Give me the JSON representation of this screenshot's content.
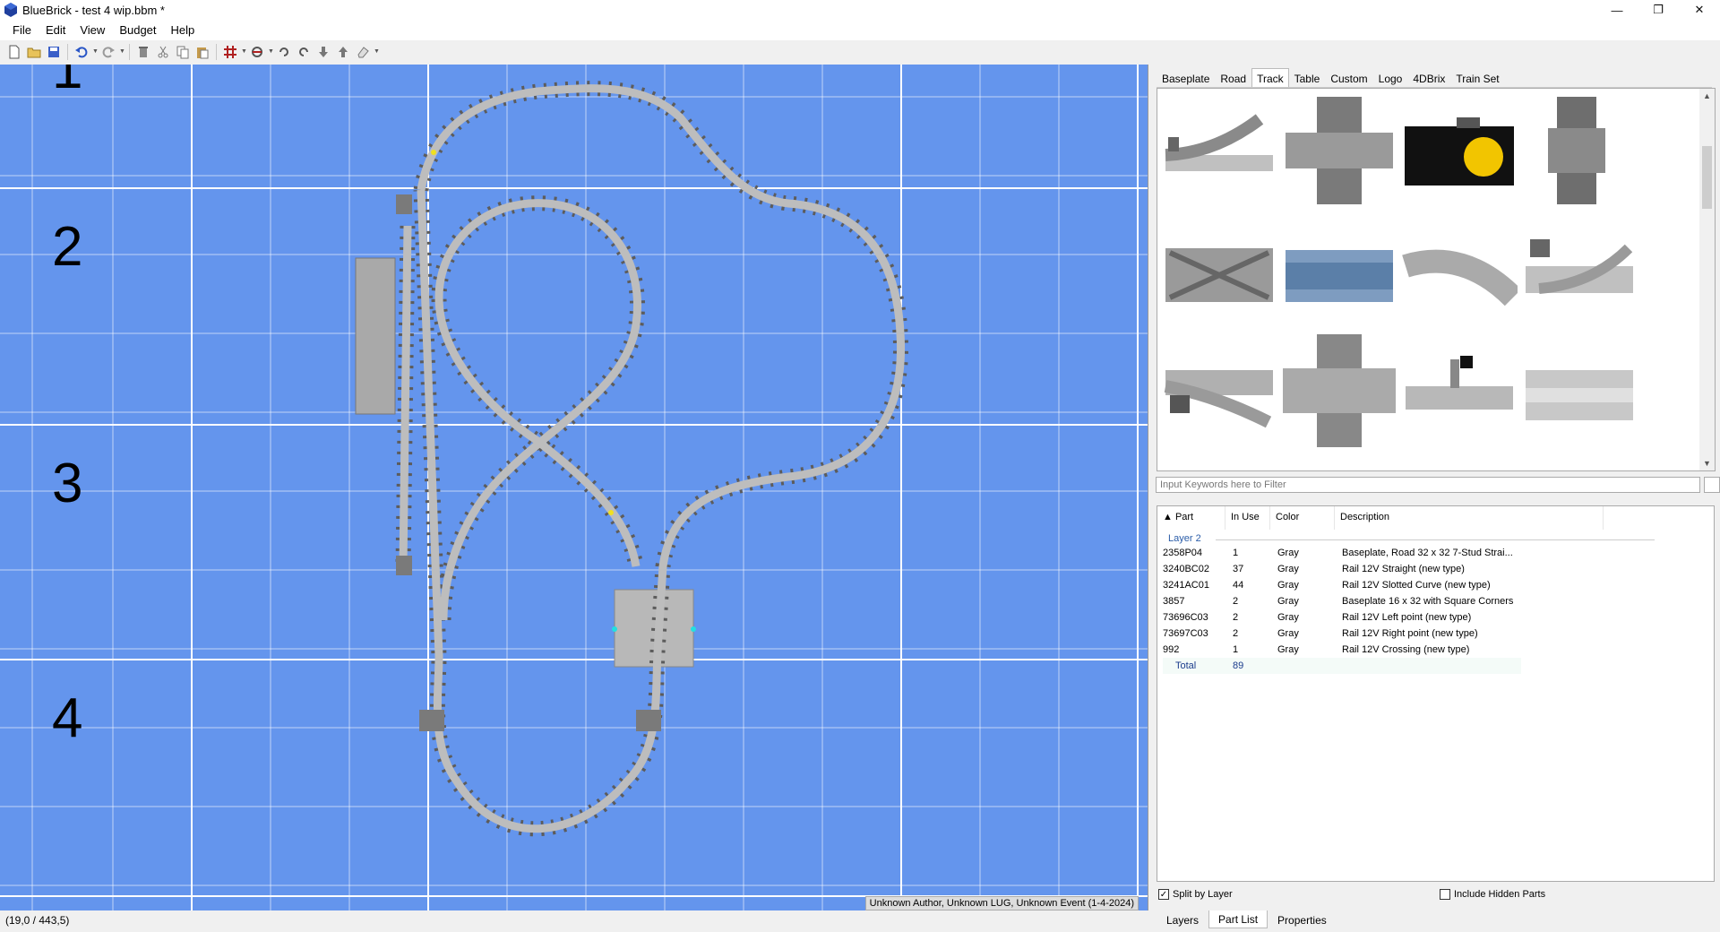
{
  "window": {
    "title": "BlueBrick - test 4 wip.bbm *",
    "controls": {
      "minimize": "—",
      "maximize": "❐",
      "close": "✕"
    }
  },
  "menu": [
    {
      "label": "File"
    },
    {
      "label": "Edit"
    },
    {
      "label": "View"
    },
    {
      "label": "Budget"
    },
    {
      "label": "Help"
    }
  ],
  "toolbar": {
    "icons": [
      "new-file-icon",
      "open-folder-icon",
      "save-icon",
      "undo-icon",
      "redo-icon",
      "delete-icon",
      "cut-icon",
      "copy-icon",
      "paste-icon",
      "snap-grid-icon",
      "snap-rotation-icon",
      "rotate-left-icon",
      "rotate-right-icon",
      "send-to-back-icon",
      "bring-to-front-icon",
      "eraser-icon"
    ]
  },
  "map": {
    "background": "#6495ed",
    "grid_color": "#ffffff",
    "row_labels": [
      "1",
      "2",
      "3",
      "4"
    ],
    "footer": "Unknown Author, Unknown LUG, Unknown Event (1-4-2024)"
  },
  "status": {
    "coordinates": "(19,0 / 443,5)"
  },
  "part_library": {
    "tabs": [
      "Baseplate",
      "Road",
      "Track",
      "Table",
      "Custom",
      "Logo",
      "4DBrix",
      "Train Set"
    ],
    "active_tab": "Track",
    "filter_placeholder": "Input Keywords here to Filter"
  },
  "part_list": {
    "columns": [
      "▲ Part",
      "In Use",
      "Color",
      "Description"
    ],
    "group": "Layer 2",
    "rows": [
      {
        "part": "2358P04",
        "in_use": "1",
        "color": "Gray",
        "description": "Baseplate, Road 32 x 32 7-Stud Strai..."
      },
      {
        "part": "3240BC02",
        "in_use": "37",
        "color": "Gray",
        "description": "Rail 12V Straight (new type)"
      },
      {
        "part": "3241AC01",
        "in_use": "44",
        "color": "Gray",
        "description": "Rail 12V Slotted Curve (new type)"
      },
      {
        "part": "3857",
        "in_use": "2",
        "color": "Gray",
        "description": "Baseplate 16 x 32 with Square Corners"
      },
      {
        "part": "73696C03",
        "in_use": "2",
        "color": "Gray",
        "description": "Rail 12V Left point (new type)"
      },
      {
        "part": "73697C03",
        "in_use": "2",
        "color": "Gray",
        "description": "Rail 12V Right point (new type)"
      },
      {
        "part": "992",
        "in_use": "1",
        "color": "Gray",
        "description": "Rail 12V Crossing (new type)"
      }
    ],
    "total_label": "Total",
    "total_value": "89",
    "split_by_layer": {
      "label": "Split by Layer",
      "checked": true
    },
    "include_hidden": {
      "label": "Include Hidden Parts",
      "checked": false
    }
  },
  "bottom_tabs": [
    "Layers",
    "Part List",
    "Properties"
  ],
  "bottom_active": "Part List"
}
